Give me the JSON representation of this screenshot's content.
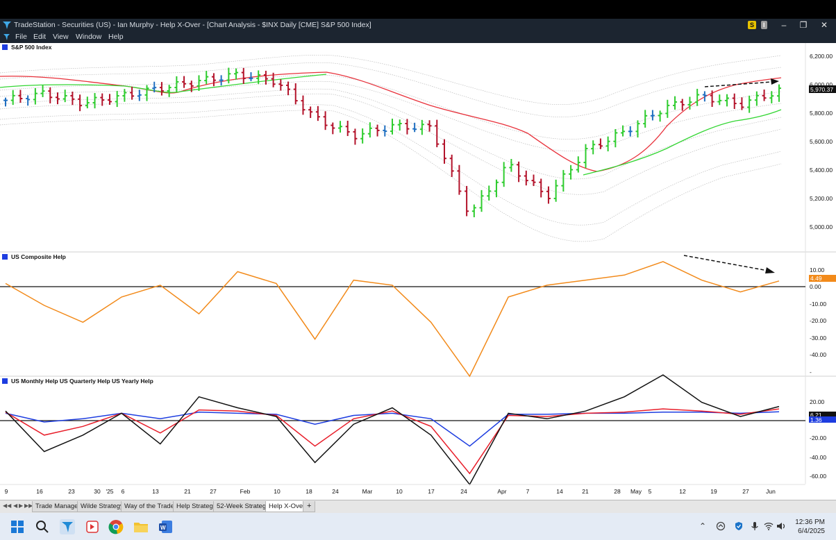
{
  "window": {
    "app_name": "TradeStation",
    "title": "TradeStation - Securities (US) - Ian Murphy - Help X-Over - [Chart Analysis - $INX Daily [CME] S&P 500 Index]",
    "badge_s": "S",
    "badge_i": "I"
  },
  "menu": [
    "File",
    "Edit",
    "View",
    "Window",
    "Help"
  ],
  "panes": {
    "price_title": "S&P 500 Index",
    "composite_title": "US Composite Help",
    "mqy_title": "US Monthly Help  US Quarterly Help  US Yearly Help"
  },
  "price_axis": [
    "6,200.00",
    "6,000.00",
    "5,800.00",
    "5,600.00",
    "5,400.00",
    "5,200.00",
    "5,000.00"
  ],
  "composite_axis": [
    "10.00",
    "0.00",
    "-10.00",
    "-20.00",
    "-30.00",
    "-40.00"
  ],
  "mqy_axis": [
    "20.00",
    "-20.00",
    "-40.00",
    "-60.00"
  ],
  "last_values": {
    "price": "5,970.37",
    "composite": "4.49",
    "monthly": "6.21",
    "yearly": "1.36"
  },
  "date_axis": [
    "9",
    "16",
    "23",
    "30",
    "'25",
    "6",
    "13",
    "21",
    "27",
    "Feb",
    "10",
    "18",
    "24",
    "Mar",
    "10",
    "17",
    "24",
    "Apr",
    "7",
    "14",
    "21",
    "28",
    "May",
    "5",
    "12",
    "19",
    "27",
    "Jun"
  ],
  "colors": {
    "up_bar": "#2ecc2e",
    "down_bar": "#b3122a",
    "neutral_bar": "#1f6fc1",
    "moving_average_fast": "#e8303a",
    "moving_average_slow": "#33d633",
    "composite_line": "#f28a1a",
    "monthly_line": "#111111",
    "quarterly_line": "#e81e2a",
    "yearly_line": "#1d3de0"
  },
  "worksheet_tabs": [
    "Trade Manager",
    "Wilde Strategy",
    "Way of the Trader",
    "Help Strategy",
    "52-Week Strategy",
    "Help X-Over"
  ],
  "active_tab": "Help X-Over",
  "taskbar": {
    "time": "12:36 PM",
    "date": "6/4/2025",
    "icons": [
      "windows-start",
      "search",
      "tradestation",
      "app-red",
      "chrome",
      "file-explorer",
      "word"
    ]
  },
  "chart_data": [
    {
      "type": "line",
      "title": "S&P 500 Index",
      "x": [
        "Jan 9",
        "Jan 16",
        "Jan 23",
        "Jan 30",
        "Feb 6",
        "Feb 13",
        "Feb 21",
        "Feb 27",
        "Mar 10",
        "Mar 18",
        "Mar 24",
        "Apr 1",
        "Apr 7",
        "Apr 14",
        "Apr 21",
        "Apr 28",
        "May 5",
        "May 12",
        "May 19",
        "May 27",
        "Jun 3"
      ],
      "series": [
        {
          "name": "",
          "values": [
            5900,
            5950,
            5880,
            5930,
            5990,
            6040,
            6090,
            6040,
            5770,
            5640,
            5710,
            5700,
            5060,
            5430,
            5190,
            5530,
            5670,
            5840,
            5930,
            5870,
            5970
          ]
        }
      ],
      "ylim": [
        4800,
        6250
      ]
    },
    {
      "type": "line",
      "title": "US Composite Help",
      "x": [
        "Jan 9",
        "Jan 16",
        "Jan 23",
        "Jan 30",
        "Feb 6",
        "Feb 13",
        "Feb 21",
        "Feb 27",
        "Mar 10",
        "Mar 18",
        "Mar 24",
        "Apr 1",
        "Apr 7",
        "Apr 14",
        "Apr 21",
        "Apr 28",
        "May 5",
        "May 12",
        "May 19",
        "May 27",
        "Jun 3"
      ],
      "series": [
        {
          "name": "",
          "values": [
            3,
            -10,
            -20,
            -5,
            2,
            -15,
            10,
            3,
            -30,
            5,
            2,
            -20,
            -52,
            -5,
            2,
            5,
            8,
            16,
            5,
            -2,
            4.49
          ]
        }
      ],
      "ylim": [
        -52,
        18
      ]
    },
    {
      "type": "line",
      "title": "US Monthly Help  US Quarterly Help  US Yearly Help",
      "x": [
        "Jan 9",
        "Jan 16",
        "Jan 23",
        "Jan 30",
        "Feb 6",
        "Feb 13",
        "Feb 21",
        "Feb 27",
        "Mar 10",
        "Mar 18",
        "Mar 24",
        "Apr 1",
        "Apr 7",
        "Apr 14",
        "Apr 21",
        "Apr 28",
        "May 5",
        "May 12",
        "May 19",
        "May 27",
        "Jun 3"
      ],
      "series": [
        {
          "name": "US Monthly Help",
          "values": [
            2,
            -35,
            -20,
            0,
            -28,
            15,
            5,
            -3,
            -45,
            -10,
            5,
            -20,
            -65,
            0,
            -5,
            2,
            15,
            35,
            10,
            -3,
            6.21
          ]
        },
        {
          "name": "US Quarterly Help",
          "values": [
            1,
            -20,
            -12,
            0,
            -18,
            3,
            2,
            -2,
            -30,
            -5,
            2,
            -12,
            -55,
            -2,
            -3,
            0,
            1,
            4,
            2,
            -1,
            4
          ]
        },
        {
          "name": "US Yearly Help",
          "values": [
            0,
            -8,
            -5,
            0,
            -5,
            1,
            0,
            -1,
            -10,
            -2,
            0,
            -5,
            -30,
            -1,
            -1,
            0,
            0,
            1,
            1,
            0,
            1.36
          ]
        }
      ],
      "ylim": [
        -65,
        30
      ]
    }
  ]
}
